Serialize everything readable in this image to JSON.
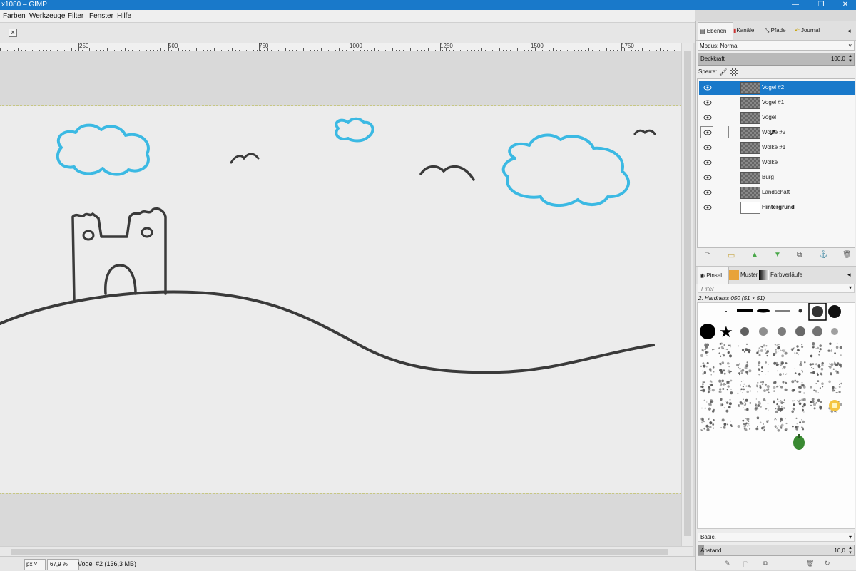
{
  "window": {
    "title": "x1080 – GIMP"
  },
  "menu": [
    "Farben",
    "Werkzeuge",
    "Filter",
    "Fenster",
    "Hilfe"
  ],
  "ruler": {
    "labels": [
      "250",
      "500",
      "750",
      "1000",
      "1250",
      "1500",
      "1750"
    ]
  },
  "status": {
    "unit": "px",
    "zoom": "67,9 %",
    "info": "Vogel #2 (136,3 MB)"
  },
  "dock": {
    "tabs": [
      "Ebenen",
      "Kanäle",
      "Pfade",
      "Journal"
    ],
    "mode_label": "Modus: Normal",
    "opacity_label": "Deckkraft",
    "opacity_value": "100,0",
    "lock_label": "Sperre:",
    "layers": [
      {
        "name": "Vogel #2",
        "selected": true
      },
      {
        "name": "Vogel #1",
        "selected": false
      },
      {
        "name": "Vogel",
        "selected": false
      },
      {
        "name": "Wolke #2",
        "selected": false
      },
      {
        "name": "Wolke #1",
        "selected": false
      },
      {
        "name": "Wolke",
        "selected": false
      },
      {
        "name": "Burg",
        "selected": false
      },
      {
        "name": "Landschaft",
        "selected": false
      },
      {
        "name": "Hintergrund",
        "selected": false
      }
    ],
    "brush_tabs": [
      "Pinsel",
      "Muster",
      "Farbverläufe"
    ],
    "filter_placeholder": "Filter",
    "brush_name": "2. Hardness 050 (51 × 51)",
    "preset": "Basic.",
    "spacing_label": "Abstand",
    "spacing_value": "10,0"
  },
  "colors": {
    "accent": "#1979ca",
    "cloud": "#3bb9e3",
    "stroke": "#3a3a3a"
  }
}
